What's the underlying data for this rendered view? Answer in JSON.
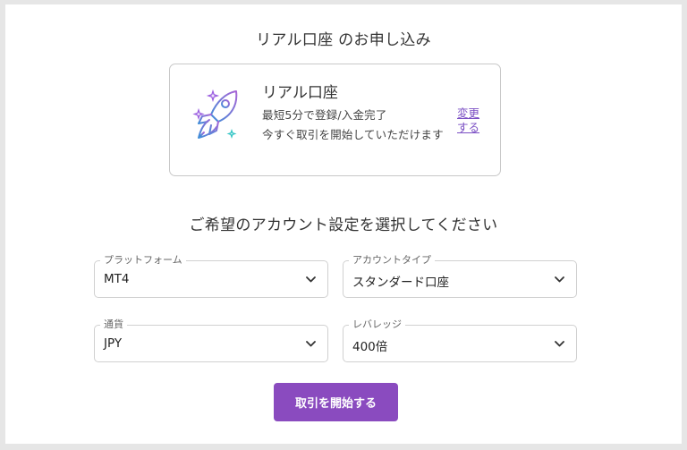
{
  "page": {
    "title": "リアル口座 のお申し込み"
  },
  "account_card": {
    "icon": "rocket-icon",
    "title": "リアル口座",
    "line1": "最短5分で登録/入金完了",
    "line2": "今すぐ取引を開始していただけます",
    "change_link": "変更する"
  },
  "settings": {
    "title": "ご希望のアカウント設定を選択してください",
    "fields": [
      {
        "label": "プラットフォーム",
        "value": "MT4"
      },
      {
        "label": "アカウントタイプ",
        "value": "スタンダード口座"
      },
      {
        "label": "通貨",
        "value": "JPY"
      },
      {
        "label": "レバレッジ",
        "value": "400倍"
      }
    ]
  },
  "submit_button": {
    "label": "取引を開始する"
  },
  "colors": {
    "accent": "#8a4bbf",
    "link": "#7b4fc4",
    "rocket_gradient_start": "#3f8ed8",
    "rocket_gradient_end": "#a865d6",
    "sparkle_purple": "#9b5fe0",
    "sparkle_teal": "#36c6c6"
  }
}
